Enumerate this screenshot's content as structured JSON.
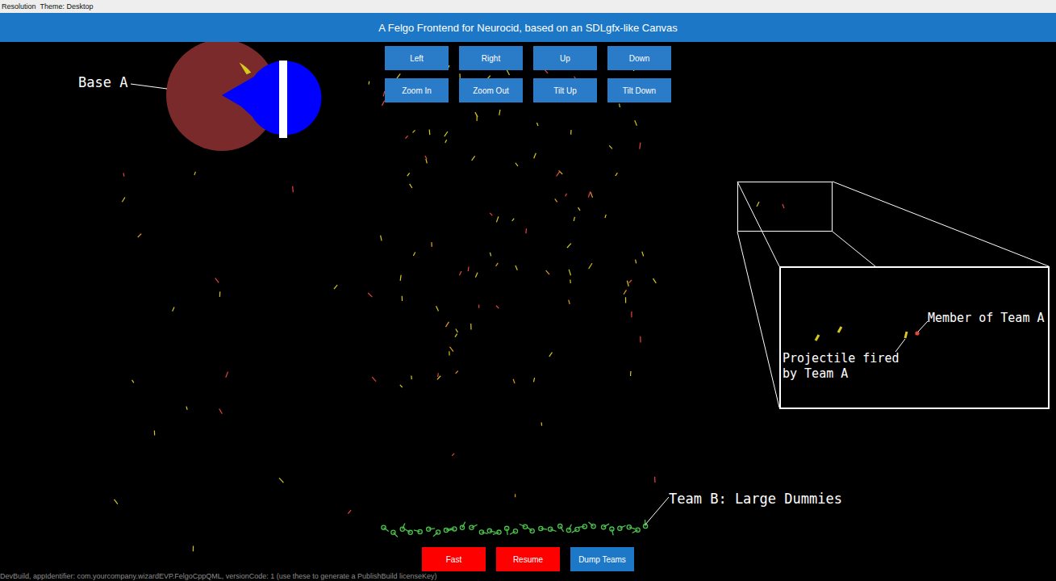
{
  "menu": [
    {
      "label": "Resolution"
    },
    {
      "label": "Theme: Desktop"
    }
  ],
  "header": {
    "title": "A Felgo Frontend for Neurocid, based on an SDLgfx-like Canvas"
  },
  "camera_buttons": [
    "Left",
    "Right",
    "Up",
    "Down",
    "Zoom In",
    "Zoom Out",
    "Tilt Up",
    "Tilt Down"
  ],
  "annotations": {
    "base": "Base A",
    "member": "Member of Team A",
    "projectile": "Projectile fired by Team A",
    "team_b": "Team B: Large Dummies"
  },
  "team_a": {
    "color": "#e8453c",
    "projectile_color": "#d6c91e"
  },
  "team_b": {
    "color": "#4cc24c"
  },
  "control_buttons": [
    {
      "label": "Fast",
      "color": "#ff0000"
    },
    {
      "label": "Resume",
      "color": "#ff0000"
    },
    {
      "label": "Dump Teams",
      "color": "#1e78c8"
    }
  ],
  "footer": "DevBuild, appIdentifier: com.yourcompany.wizardEVP.FelgoCppQML, versionCode: 1 (use these to generate a PublishBuild licenseKey)"
}
